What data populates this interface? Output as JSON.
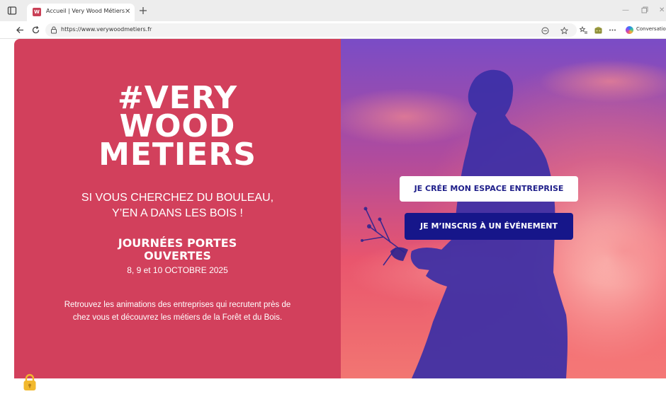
{
  "browser": {
    "tab_title": "Accueil | Very Wood Métiers",
    "favicon_letter": "W",
    "url": "https://www.verywoodmetiers.fr",
    "copilot_label": "Conversation",
    "icons": {
      "tab_actions": "tab-actions-icon",
      "new_tab": "plus-icon",
      "back": "back-arrow-icon",
      "refresh": "refresh-icon",
      "lock": "lock-icon",
      "read_aloud": "read-aloud-icon",
      "favorite": "star-icon",
      "favorites": "favorites-icon",
      "extensions": "extension-icon",
      "more": "more-icon",
      "minimize": "minimize-icon",
      "restore": "restore-icon",
      "close": "close-icon"
    },
    "colors": {
      "tab_bar": "#ededed",
      "omnibox": "#f3f3f3"
    }
  },
  "hero": {
    "logo_lines": [
      "#VERY",
      "WOOD",
      "METIERS"
    ],
    "tagline_lines": [
      "SI VOUS CHERCHEZ DU BOULEAU,",
      "Y’EN A DANS LES BOIS !"
    ],
    "event_title_lines": [
      "JOURNÉES PORTES",
      "OUVERTES"
    ],
    "event_dates": "8, 9 et 10 OCTOBRE 2025",
    "intro_lines": [
      "Retrouvez les animations des entreprises qui recrutent près de",
      "chez vous et découvrez les métiers de la Forêt et du Bois."
    ],
    "buttons": {
      "company": "JE CRÉE MON ESPACE ENTREPRISE",
      "event": "JE M’INSCRIS À UN ÉVÉNEMENT"
    },
    "colors": {
      "brand_pink": "#d2405c",
      "navy": "#16168a",
      "white": "#ffffff"
    }
  },
  "cookie_badge": {
    "icon": "cookie-lock-icon"
  }
}
